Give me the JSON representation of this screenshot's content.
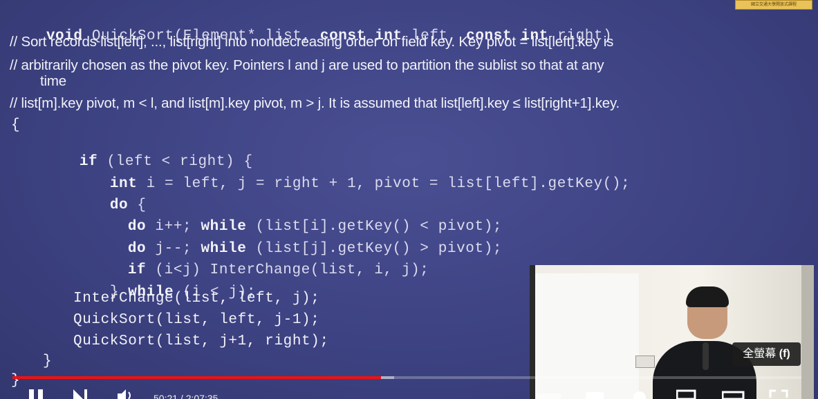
{
  "logo": {
    "text": "國立交通大學開放式課程"
  },
  "slide": {
    "signature": {
      "kw1": "void",
      "t1": " QuickSort(Element* list, ",
      "kw2": "const int",
      "t2": " left, ",
      "kw3": "const int",
      "t3": " right)"
    },
    "comments": [
      "// Sort records list[left], ..., list[right] into nondecreasing order on field key. Key pivot = list[left].key is",
      "// arbitrarily chosen as the pivot key. Pointers l and j are used to partition the sublist so that at any",
      "time",
      "// list[m].key pivot, m < l, and list[m].key pivot, m > j. It is assumed that list[left].key ≤ list[right+1].key."
    ],
    "open_brace": "{",
    "code": {
      "if_kw": "if",
      "if_rest": " (left < right) {",
      "int_kw": "int",
      "int_rest": " i = left, j = right + 1, pivot = list[left].getKey();",
      "do_kw": "do",
      "do_rest": " {",
      "do1_kw": "do",
      "do1_mid": " i++; ",
      "do1_kw2": "while",
      "do1_rest": " (list[i].getKey() < pivot);",
      "do2_kw": "do",
      "do2_mid": " j--; ",
      "do2_kw2": "while",
      "do2_rest": " (list[j].getKey() > pivot);",
      "if2_kw": "if",
      "if2_rest": " (i<j) InterChange(list, i, j);",
      "endwhile_brace": "} ",
      "endwhile_kw": "while",
      "endwhile_rest": " (i < j);",
      "interchange": "InterChange(list, left, j);",
      "qs1": "QuickSort(list, left, j-1);",
      "qs2": "QuickSort(list, j+1, right);",
      "close_inner": "}"
    },
    "close_brace": "}"
  },
  "tooltip": {
    "text": "全螢幕",
    "shortcut": "(f)"
  },
  "progress": {
    "played_fraction": 0.467,
    "buffered_fraction": 0.484
  },
  "controls": {
    "time": "50:21 / 2:07:35"
  },
  "colors": {
    "slide_bg": "#3d4282",
    "progress_red": "#ee1111"
  }
}
